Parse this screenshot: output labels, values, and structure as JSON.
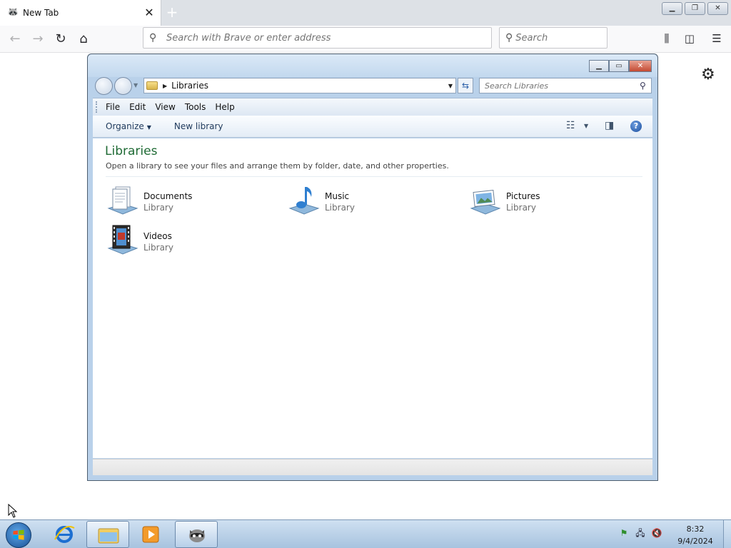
{
  "browser": {
    "tab": {
      "title": "New Tab",
      "favicon": "raccoon-icon"
    },
    "address_placeholder": "Search with Brave or enter address",
    "search_placeholder": "Search"
  },
  "explorer": {
    "breadcrumb": "Libraries",
    "search_placeholder": "Search Libraries",
    "menu": [
      "File",
      "Edit",
      "View",
      "Tools",
      "Help"
    ],
    "commands": {
      "organize": "Organize",
      "new_library": "New library"
    },
    "heading": "Libraries",
    "subheading": "Open a library to see your files and arrange them by folder, date, and other properties.",
    "libraries": [
      {
        "name": "Documents",
        "type": "Library",
        "icon": "documents-library-icon"
      },
      {
        "name": "Music",
        "type": "Library",
        "icon": "music-library-icon"
      },
      {
        "name": "Pictures",
        "type": "Library",
        "icon": "pictures-library-icon"
      },
      {
        "name": "Videos",
        "type": "Library",
        "icon": "videos-library-icon"
      }
    ]
  },
  "taskbar": {
    "clock_time": "8:32",
    "clock_date": "9/4/2024",
    "pinned": [
      "internet-explorer-icon",
      "windows-explorer-icon",
      "media-player-icon",
      "browser-raccoon-icon"
    ]
  },
  "colors": {
    "heading_green": "#1e6a34",
    "taskbar": "#a8c3df",
    "window_frame": "#b9d1ea"
  }
}
